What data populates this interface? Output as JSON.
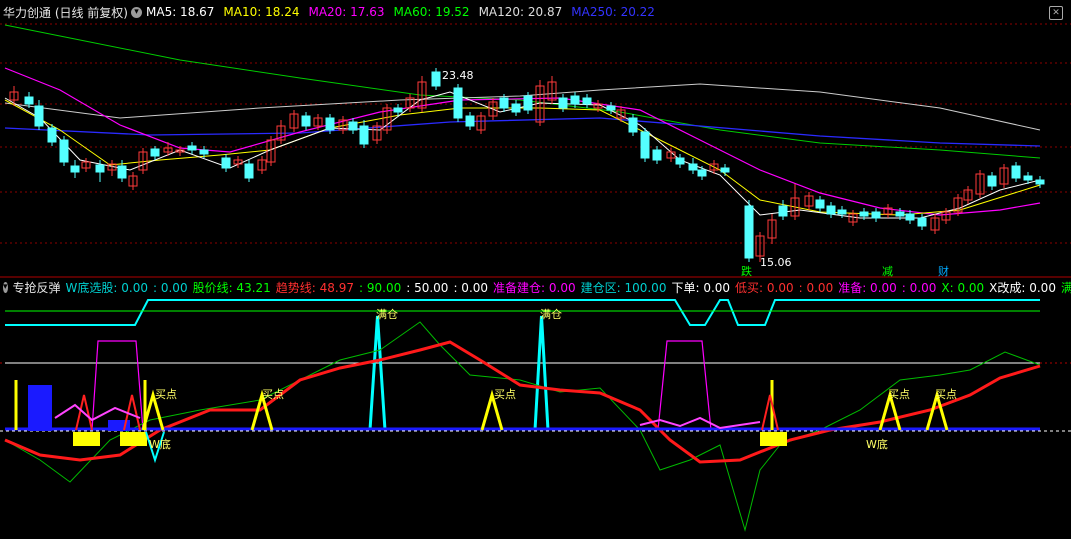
{
  "header": {
    "title": "华力创通 (日线 前复权)",
    "ma": [
      {
        "label": "MA5: 18.67",
        "color": "#ffffff"
      },
      {
        "label": "MA10: 18.24",
        "color": "#ffff00"
      },
      {
        "label": "MA20: 17.63",
        "color": "#ff00ff"
      },
      {
        "label": "MA60: 19.52",
        "color": "#00ff00"
      },
      {
        "label": "MA120: 20.87",
        "color": "#dddddd"
      },
      {
        "label": "MA250: 20.22",
        "color": "#3333ff"
      }
    ]
  },
  "main_chart": {
    "high_label": "23.48",
    "low_label": "15.06",
    "markers": [
      {
        "text": "跌",
        "color": "#00ff00"
      },
      {
        "text": "减",
        "color": "#00ff00"
      },
      {
        "text": "财",
        "color": "#00aaff"
      }
    ]
  },
  "sub_header": {
    "title": "专抢反弹",
    "items": [
      {
        "label": "W底选股: 0.00",
        "color": "#00d0d0"
      },
      {
        "label": ": 0.00",
        "color": "#00d0d0"
      },
      {
        "label": "股价线: 43.21",
        "color": "#00ff00"
      },
      {
        "label": "趋势线: 48.97",
        "color": "#ff3030"
      },
      {
        "label": ": 90.00",
        "color": "#00ff00"
      },
      {
        "label": ": 50.00",
        "color": "#ffffff"
      },
      {
        "label": ": 0.00",
        "color": "#ffffff"
      },
      {
        "label": "准备建仓: 0.00",
        "color": "#ff00ff"
      },
      {
        "label": "建仓区: 100.00",
        "color": "#00d0d0"
      },
      {
        "label": "下单: 0.00",
        "color": "#ffffff"
      },
      {
        "label": "低买: 0.00",
        "color": "#ff3030"
      },
      {
        "label": ": 0.00",
        "color": "#ff3030"
      },
      {
        "label": "准备: 0.00",
        "color": "#ff00ff"
      },
      {
        "label": ": 0.00",
        "color": "#ff00ff"
      },
      {
        "label": "X: 0.00",
        "color": "#00ff00"
      },
      {
        "label": "X改成: 0.00",
        "color": "#ffffff"
      },
      {
        "label": "满仓选",
        "color": "#00ff00"
      }
    ]
  },
  "sub_chart": {
    "man_cang": "满仓",
    "mai_dian": "买点",
    "w_di": "W底"
  },
  "colors": {
    "up": "#ff3a3a",
    "down": "#54ffff",
    "grid": "#8b0000",
    "trend": "#ff2020",
    "price": "#00dd00"
  }
}
